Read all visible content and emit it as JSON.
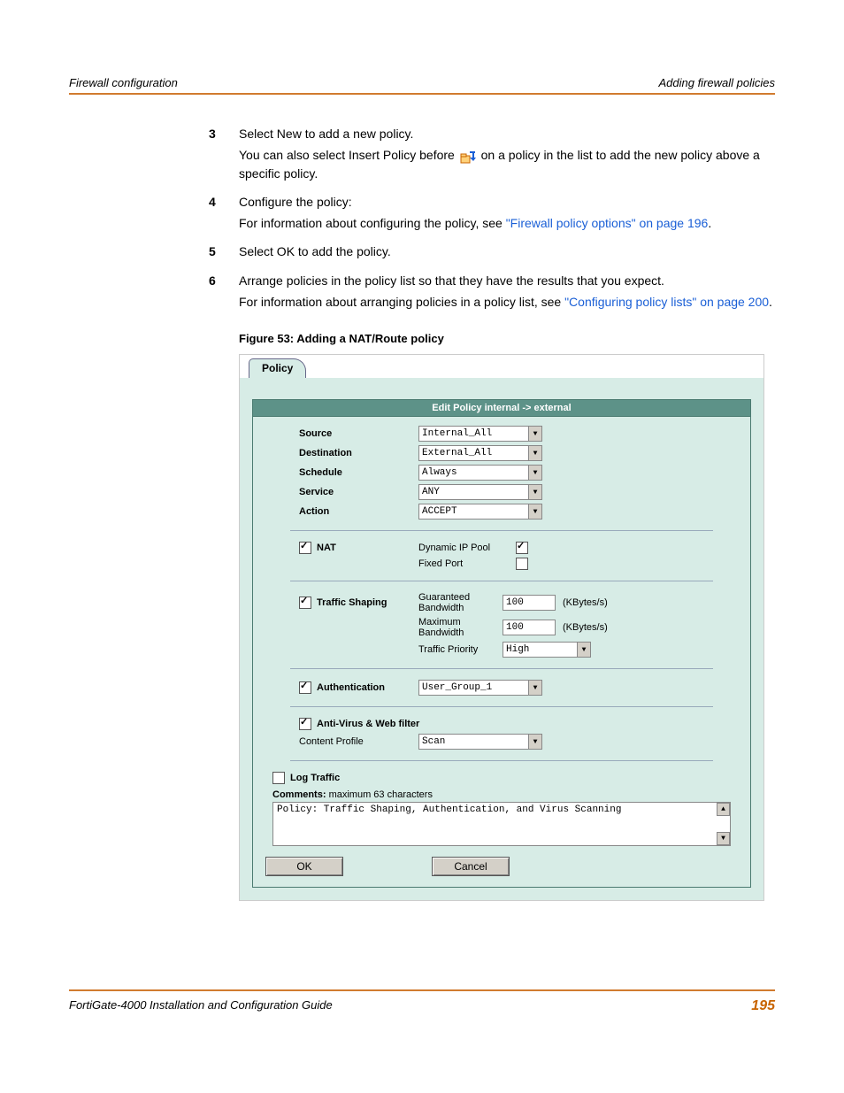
{
  "header": {
    "left": "Firewall configuration",
    "right": "Adding firewall policies"
  },
  "steps": {
    "s3": {
      "num": "3",
      "line1": "Select New to add a new policy.",
      "line2a": "You can also select Insert Policy before ",
      "line2b": " on a policy in the list to add the new policy above a specific policy."
    },
    "s4": {
      "num": "4",
      "line1": "Configure the policy:",
      "line2a": "For information about configuring the policy, see ",
      "link": "\"Firewall policy options\" on page 196",
      "line2b": "."
    },
    "s5": {
      "num": "5",
      "line1": "Select OK to add the policy."
    },
    "s6": {
      "num": "6",
      "line1": "Arrange policies in the policy list so that they have the results that you expect.",
      "line2a": "For information about arranging policies in a policy list, see ",
      "link": "\"Configuring policy lists\" on page 200",
      "line2b": "."
    }
  },
  "figure": {
    "caption": "Figure 53: Adding a NAT/Route policy"
  },
  "policy": {
    "tab": "Policy",
    "title": "Edit Policy internal -> external",
    "rows": {
      "source": {
        "label": "Source",
        "value": "Internal_All"
      },
      "destination": {
        "label": "Destination",
        "value": "External_All"
      },
      "schedule": {
        "label": "Schedule",
        "value": "Always"
      },
      "service": {
        "label": "Service",
        "value": "ANY"
      },
      "action": {
        "label": "Action",
        "value": "ACCEPT"
      }
    },
    "nat": {
      "label": "NAT",
      "dyn_label": "Dynamic IP Pool",
      "fixed_label": "Fixed Port"
    },
    "shaping": {
      "label": "Traffic Shaping",
      "guaranteed_label": "Guaranteed Bandwidth",
      "guaranteed_value": "100",
      "unit1": "(KBytes/s)",
      "maximum_label": "Maximum Bandwidth",
      "maximum_value": "100",
      "unit2": "(KBytes/s)",
      "priority_label": "Traffic Priority",
      "priority_value": "High"
    },
    "auth": {
      "label": "Authentication",
      "value": "User_Group_1"
    },
    "av": {
      "label": "Anti-Virus & Web filter",
      "profile_label": "Content Profile",
      "profile_value": "Scan"
    },
    "log": {
      "label": "Log Traffic"
    },
    "comments": {
      "label": "Comments:",
      "hint": " maximum 63 characters",
      "text": "Policy: Traffic Shaping, Authentication, and Virus Scanning"
    },
    "buttons": {
      "ok": "OK",
      "cancel": "Cancel"
    }
  },
  "footer": {
    "left": "FortiGate-4000 Installation and Configuration Guide",
    "page": "195"
  }
}
